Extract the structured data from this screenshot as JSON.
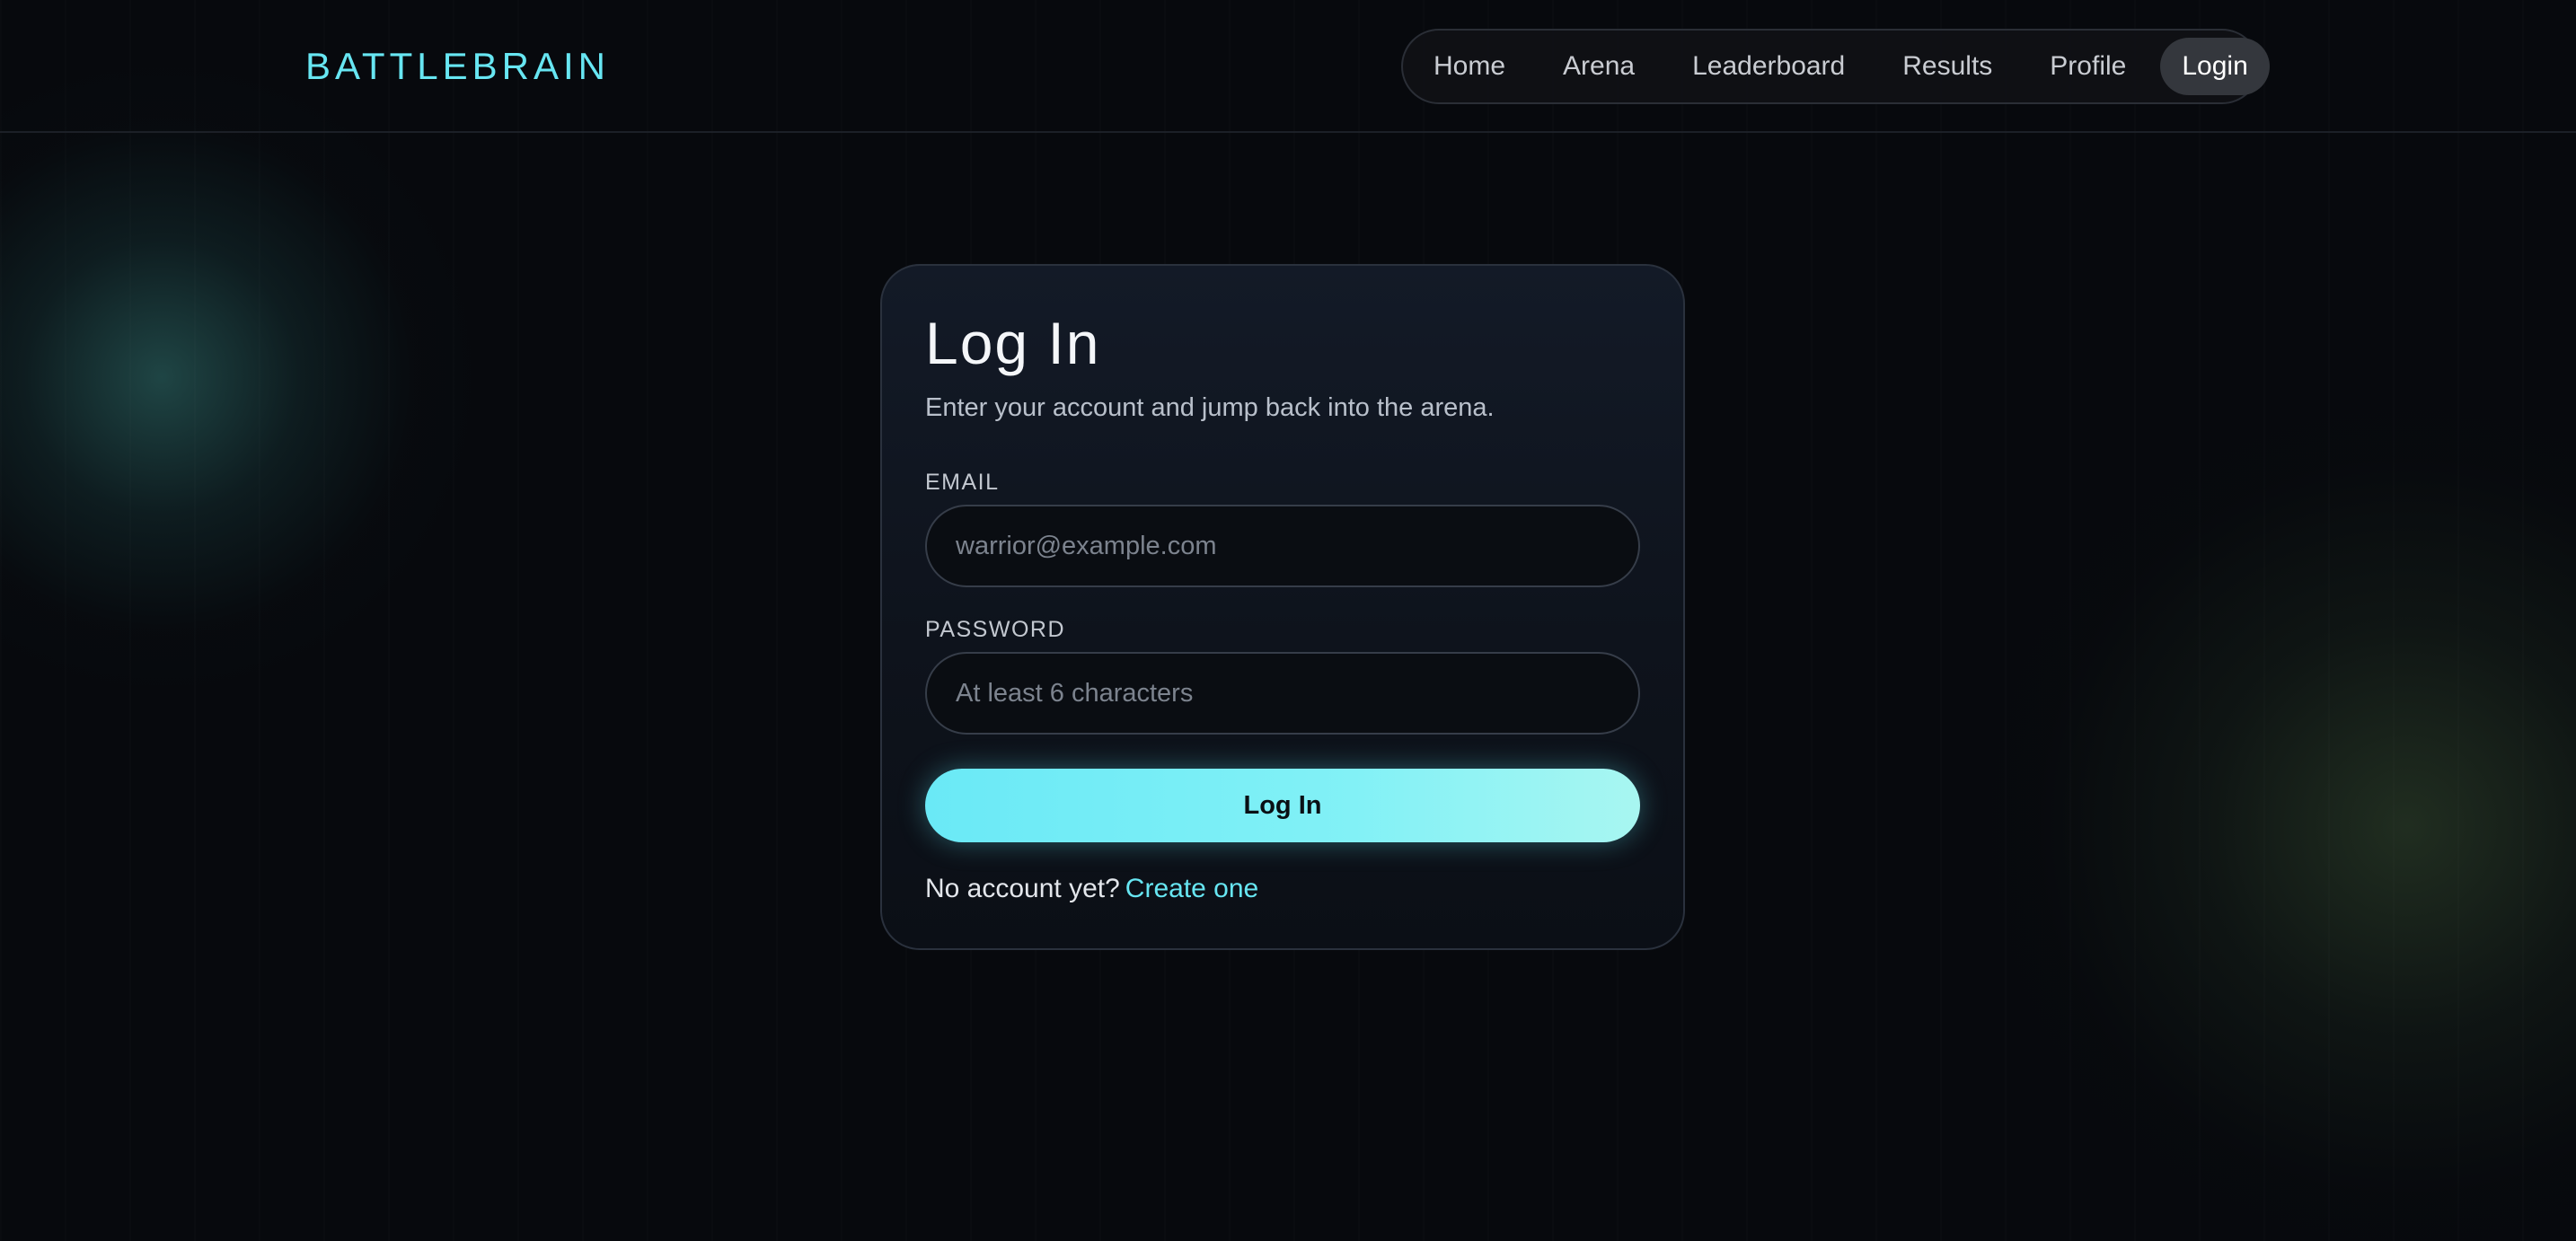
{
  "brand": {
    "name": "BATTLEBRAIN"
  },
  "nav": {
    "items": [
      {
        "label": "Home"
      },
      {
        "label": "Arena"
      },
      {
        "label": "Leaderboard"
      },
      {
        "label": "Results"
      },
      {
        "label": "Profile"
      },
      {
        "label": "Login",
        "active": true
      }
    ]
  },
  "login": {
    "title": "Log In",
    "subtitle": "Enter your account and jump back into the arena.",
    "email": {
      "label": "EMAIL",
      "placeholder": "warrior@example.com",
      "value": ""
    },
    "password": {
      "label": "PASSWORD",
      "placeholder": "At least 6 characters",
      "value": ""
    },
    "submit_label": "Log In",
    "signup_prompt": "No account yet?",
    "signup_link": "Create one"
  },
  "colors": {
    "accent": "#67e6f2",
    "background": "#07090d",
    "card": "#131a27"
  }
}
